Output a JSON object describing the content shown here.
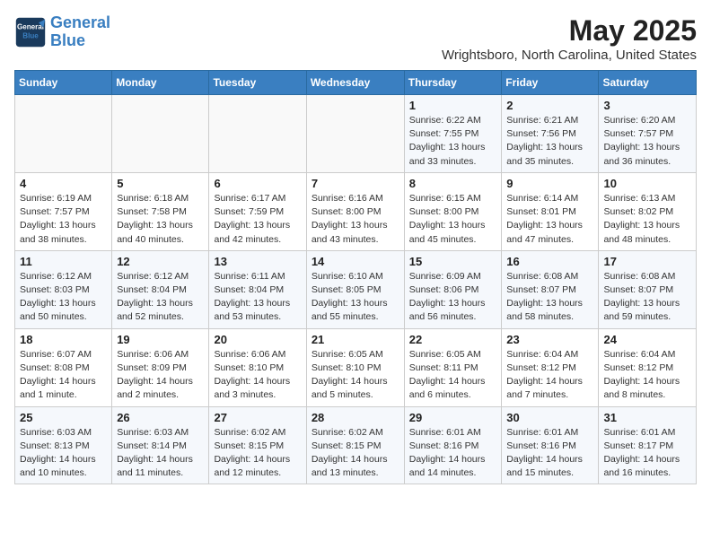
{
  "header": {
    "logo_line1": "General",
    "logo_line2": "Blue",
    "title": "May 2025",
    "subtitle": "Wrightsboro, North Carolina, United States"
  },
  "days_of_week": [
    "Sunday",
    "Monday",
    "Tuesday",
    "Wednesday",
    "Thursday",
    "Friday",
    "Saturday"
  ],
  "weeks": [
    [
      {
        "day": "",
        "info": ""
      },
      {
        "day": "",
        "info": ""
      },
      {
        "day": "",
        "info": ""
      },
      {
        "day": "",
        "info": ""
      },
      {
        "day": "1",
        "info": "Sunrise: 6:22 AM\nSunset: 7:55 PM\nDaylight: 13 hours\nand 33 minutes."
      },
      {
        "day": "2",
        "info": "Sunrise: 6:21 AM\nSunset: 7:56 PM\nDaylight: 13 hours\nand 35 minutes."
      },
      {
        "day": "3",
        "info": "Sunrise: 6:20 AM\nSunset: 7:57 PM\nDaylight: 13 hours\nand 36 minutes."
      }
    ],
    [
      {
        "day": "4",
        "info": "Sunrise: 6:19 AM\nSunset: 7:57 PM\nDaylight: 13 hours\nand 38 minutes."
      },
      {
        "day": "5",
        "info": "Sunrise: 6:18 AM\nSunset: 7:58 PM\nDaylight: 13 hours\nand 40 minutes."
      },
      {
        "day": "6",
        "info": "Sunrise: 6:17 AM\nSunset: 7:59 PM\nDaylight: 13 hours\nand 42 minutes."
      },
      {
        "day": "7",
        "info": "Sunrise: 6:16 AM\nSunset: 8:00 PM\nDaylight: 13 hours\nand 43 minutes."
      },
      {
        "day": "8",
        "info": "Sunrise: 6:15 AM\nSunset: 8:00 PM\nDaylight: 13 hours\nand 45 minutes."
      },
      {
        "day": "9",
        "info": "Sunrise: 6:14 AM\nSunset: 8:01 PM\nDaylight: 13 hours\nand 47 minutes."
      },
      {
        "day": "10",
        "info": "Sunrise: 6:13 AM\nSunset: 8:02 PM\nDaylight: 13 hours\nand 48 minutes."
      }
    ],
    [
      {
        "day": "11",
        "info": "Sunrise: 6:12 AM\nSunset: 8:03 PM\nDaylight: 13 hours\nand 50 minutes."
      },
      {
        "day": "12",
        "info": "Sunrise: 6:12 AM\nSunset: 8:04 PM\nDaylight: 13 hours\nand 52 minutes."
      },
      {
        "day": "13",
        "info": "Sunrise: 6:11 AM\nSunset: 8:04 PM\nDaylight: 13 hours\nand 53 minutes."
      },
      {
        "day": "14",
        "info": "Sunrise: 6:10 AM\nSunset: 8:05 PM\nDaylight: 13 hours\nand 55 minutes."
      },
      {
        "day": "15",
        "info": "Sunrise: 6:09 AM\nSunset: 8:06 PM\nDaylight: 13 hours\nand 56 minutes."
      },
      {
        "day": "16",
        "info": "Sunrise: 6:08 AM\nSunset: 8:07 PM\nDaylight: 13 hours\nand 58 minutes."
      },
      {
        "day": "17",
        "info": "Sunrise: 6:08 AM\nSunset: 8:07 PM\nDaylight: 13 hours\nand 59 minutes."
      }
    ],
    [
      {
        "day": "18",
        "info": "Sunrise: 6:07 AM\nSunset: 8:08 PM\nDaylight: 14 hours\nand 1 minute."
      },
      {
        "day": "19",
        "info": "Sunrise: 6:06 AM\nSunset: 8:09 PM\nDaylight: 14 hours\nand 2 minutes."
      },
      {
        "day": "20",
        "info": "Sunrise: 6:06 AM\nSunset: 8:10 PM\nDaylight: 14 hours\nand 3 minutes."
      },
      {
        "day": "21",
        "info": "Sunrise: 6:05 AM\nSunset: 8:10 PM\nDaylight: 14 hours\nand 5 minutes."
      },
      {
        "day": "22",
        "info": "Sunrise: 6:05 AM\nSunset: 8:11 PM\nDaylight: 14 hours\nand 6 minutes."
      },
      {
        "day": "23",
        "info": "Sunrise: 6:04 AM\nSunset: 8:12 PM\nDaylight: 14 hours\nand 7 minutes."
      },
      {
        "day": "24",
        "info": "Sunrise: 6:04 AM\nSunset: 8:12 PM\nDaylight: 14 hours\nand 8 minutes."
      }
    ],
    [
      {
        "day": "25",
        "info": "Sunrise: 6:03 AM\nSunset: 8:13 PM\nDaylight: 14 hours\nand 10 minutes."
      },
      {
        "day": "26",
        "info": "Sunrise: 6:03 AM\nSunset: 8:14 PM\nDaylight: 14 hours\nand 11 minutes."
      },
      {
        "day": "27",
        "info": "Sunrise: 6:02 AM\nSunset: 8:15 PM\nDaylight: 14 hours\nand 12 minutes."
      },
      {
        "day": "28",
        "info": "Sunrise: 6:02 AM\nSunset: 8:15 PM\nDaylight: 14 hours\nand 13 minutes."
      },
      {
        "day": "29",
        "info": "Sunrise: 6:01 AM\nSunset: 8:16 PM\nDaylight: 14 hours\nand 14 minutes."
      },
      {
        "day": "30",
        "info": "Sunrise: 6:01 AM\nSunset: 8:16 PM\nDaylight: 14 hours\nand 15 minutes."
      },
      {
        "day": "31",
        "info": "Sunrise: 6:01 AM\nSunset: 8:17 PM\nDaylight: 14 hours\nand 16 minutes."
      }
    ]
  ]
}
